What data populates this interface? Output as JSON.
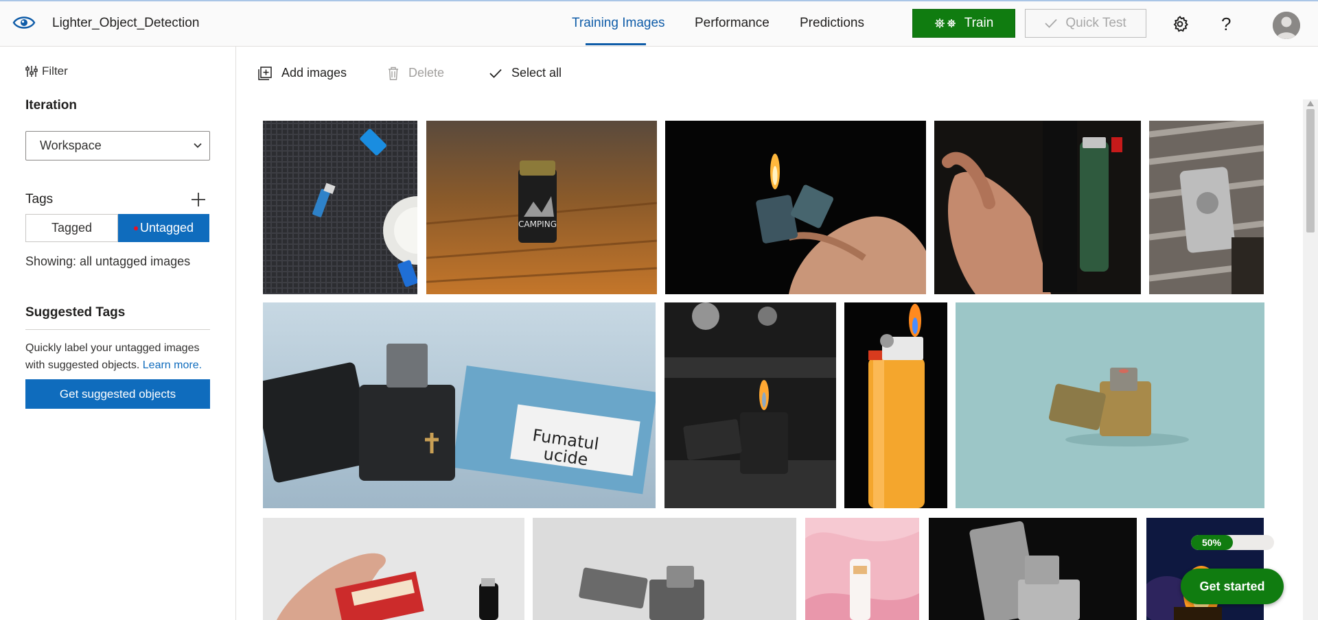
{
  "header": {
    "project_title": "Lighter_Object_Detection",
    "tabs": [
      {
        "label": "Training Images",
        "active": true
      },
      {
        "label": "Performance",
        "active": false
      },
      {
        "label": "Predictions",
        "active": false
      }
    ],
    "train_label": "Train",
    "quick_test_label": "Quick Test",
    "settings_icon": "gear-icon",
    "help_label": "?",
    "brand_color": "#0f5ca8",
    "train_color": "#107c10"
  },
  "sidebar": {
    "filter_label": "Filter",
    "iteration_heading": "Iteration",
    "iteration_value": "Workspace",
    "tags_heading": "Tags",
    "tagged_label": "Tagged",
    "untagged_label": "Untagged",
    "showing_text": "Showing: all untagged images",
    "suggested_heading": "Suggested Tags",
    "suggested_desc": "Quickly label your untagged images with suggested objects.",
    "learn_more": "Learn more.",
    "suggest_button": "Get suggested objects"
  },
  "toolbar": {
    "add_images": "Add images",
    "delete": "Delete",
    "select_all": "Select all"
  },
  "gallery": {
    "images": [
      {
        "subject": "blue disposable lighters on dark mesh"
      },
      {
        "subject": "black camping lighter on wooden table"
      },
      {
        "subject": "hand holding lit zippo on black"
      },
      {
        "subject": "hand holding black case and green lighter"
      },
      {
        "subject": "silver engraved lighter on wood"
      },
      {
        "subject": "black zippo with cross and cigarette pack"
      },
      {
        "subject": "lit black zippo on dark table"
      },
      {
        "subject": "orange disposable lighter with flame"
      },
      {
        "subject": "brass zippo on teal background"
      },
      {
        "subject": "hand taking cigarettes with black lighter"
      },
      {
        "subject": "silver zippo lighters on grey"
      },
      {
        "subject": "white lighter on pink fabric"
      },
      {
        "subject": "silver zippo on black"
      },
      {
        "subject": "lighter with flames at night"
      }
    ]
  },
  "get_started": {
    "progress": 0.5,
    "progress_label": "50%",
    "button_label": "Get started"
  }
}
